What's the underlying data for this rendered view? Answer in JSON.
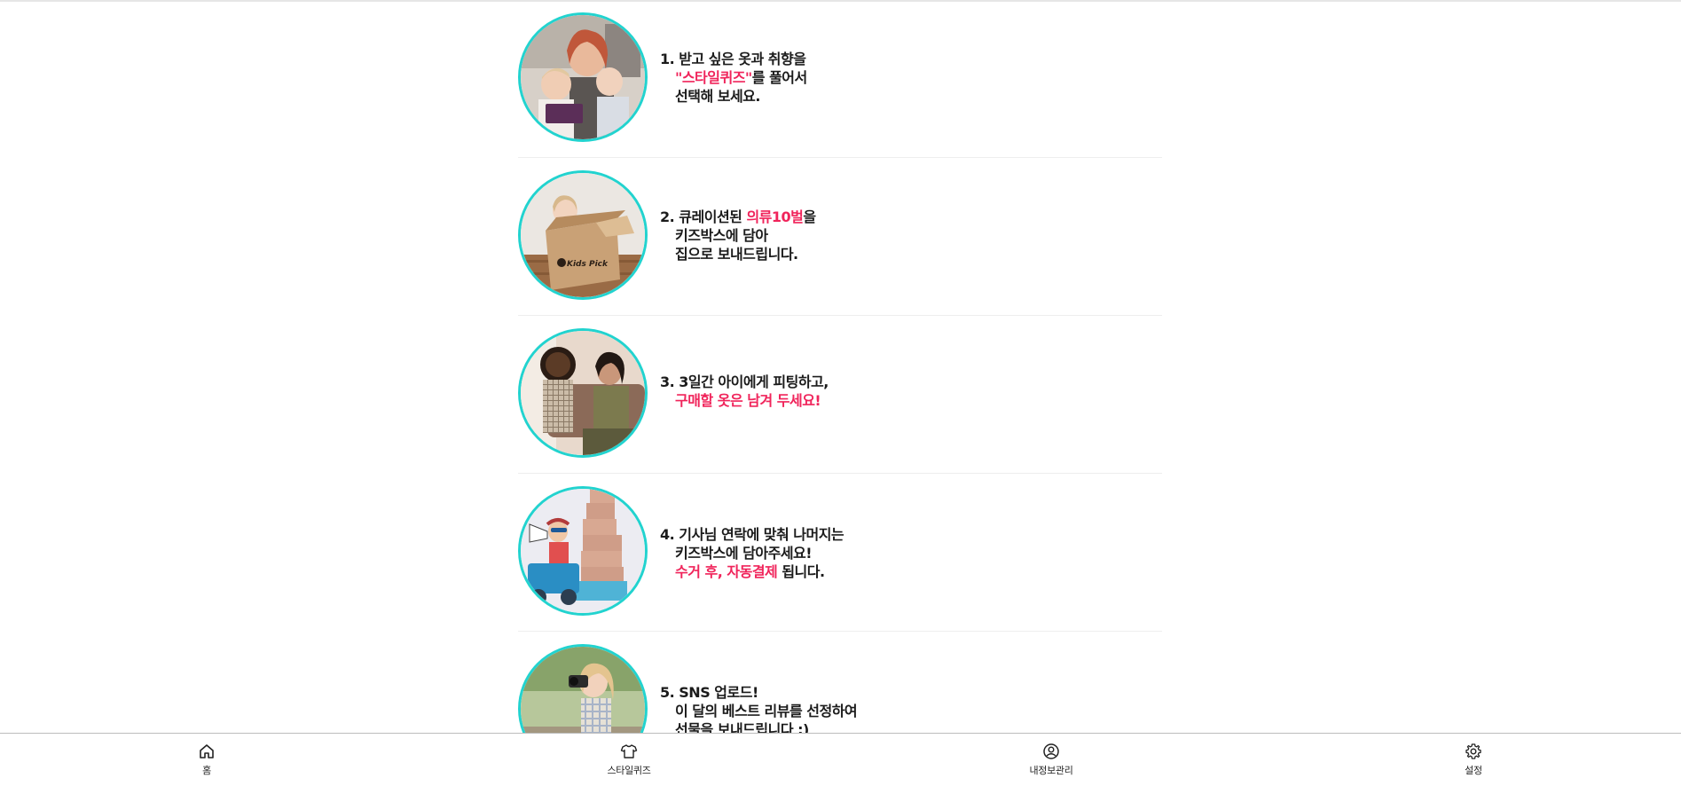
{
  "steps": [
    {
      "photo": "mother-with-two-children-and-tablet",
      "lines": [
        [
          {
            "t": "1. 받고 싶은 옷과 취향을",
            "hl": false
          }
        ],
        [
          {
            "t": "\"스타일퀴즈\"",
            "hl": true
          },
          {
            "t": "를 풀어서",
            "hl": false
          }
        ],
        [
          {
            "t": "선택해 보세요.",
            "hl": false
          }
        ]
      ]
    },
    {
      "photo": "child-in-kids-pick-box",
      "box_brand": "Kids Pick",
      "lines": [
        [
          {
            "t": "2. 큐레이션된 ",
            "hl": false
          },
          {
            "t": "의류10벌",
            "hl": true
          },
          {
            "t": "을",
            "hl": false
          }
        ],
        [
          {
            "t": "키즈박스에 담아",
            "hl": false
          }
        ],
        [
          {
            "t": "집으로 보내드립니다.",
            "hl": false
          }
        ]
      ]
    },
    {
      "photo": "mother-fitting-clothes-on-child",
      "lines": [
        [
          {
            "t": "3. 3일간 아이에게 피팅하고,",
            "hl": false
          }
        ],
        [
          {
            "t": "구매할 옷은 남겨 두세요!",
            "hl": true
          }
        ]
      ]
    },
    {
      "photo": "child-with-megaphone-and-boxes",
      "lines": [
        [
          {
            "t": "4. 기사님 연락에 맞춰 나머지는",
            "hl": false
          }
        ],
        [
          {
            "t": "키즈박스에 담아주세요!",
            "hl": false
          }
        ],
        [
          {
            "t": "수거 후, 자동결제",
            "hl": true
          },
          {
            "t": " 됩니다.",
            "hl": false
          }
        ]
      ]
    },
    {
      "photo": "girl-with-camera",
      "lines": [
        [
          {
            "t": "5. SNS 업로드!",
            "hl": false
          }
        ],
        [
          {
            "t": "이 달의 베스트 리뷰를 선정하여",
            "hl": false
          }
        ],
        [
          {
            "t": "선물을 보내드립니다 :)",
            "hl": false
          }
        ]
      ]
    }
  ],
  "tabbar": {
    "tabs": [
      {
        "label": "홈",
        "icon": "home-icon"
      },
      {
        "label": "스타일퀴즈",
        "icon": "shirt-icon"
      },
      {
        "label": "내정보관리",
        "icon": "user-circle-icon"
      },
      {
        "label": "설정",
        "icon": "gear-icon"
      }
    ]
  },
  "colors": {
    "accent": "#f0245b",
    "photo_ring": "#22d3cf",
    "text": "#1b1b1b"
  }
}
